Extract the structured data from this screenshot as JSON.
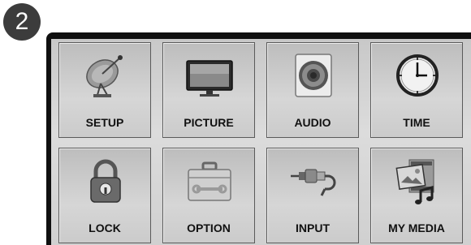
{
  "step": {
    "number": "2"
  },
  "menu": {
    "items": [
      {
        "label": "SETUP",
        "icon": "satellite-dish-icon"
      },
      {
        "label": "PICTURE",
        "icon": "tv-monitor-icon"
      },
      {
        "label": "AUDIO",
        "icon": "speaker-icon"
      },
      {
        "label": "TIME",
        "icon": "clock-icon"
      },
      {
        "label": "LOCK",
        "icon": "padlock-icon"
      },
      {
        "label": "OPTION",
        "icon": "toolbox-icon"
      },
      {
        "label": "INPUT",
        "icon": "rca-cable-icon"
      },
      {
        "label": "MY MEDIA",
        "icon": "media-icon"
      }
    ]
  }
}
